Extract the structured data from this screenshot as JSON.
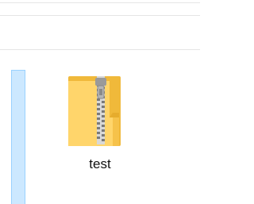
{
  "explorer": {
    "items": [
      {
        "label": "test",
        "icon": "zip-folder-icon"
      }
    ]
  },
  "colors": {
    "selection_fill": "#cce8ff",
    "selection_border": "#99d1ff",
    "folder_body": "#ffd56b",
    "folder_back": "#f0b93a",
    "zipper": "#8c8c8c"
  }
}
